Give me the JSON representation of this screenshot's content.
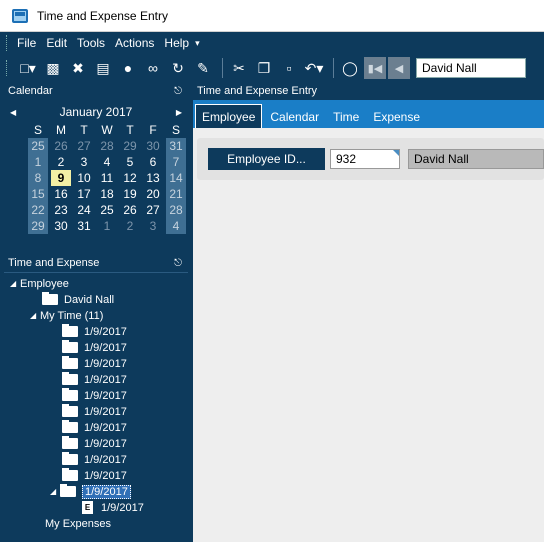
{
  "window": {
    "title": "Time and Expense Entry"
  },
  "menu": [
    "File",
    "Edit",
    "Tools",
    "Actions",
    "Help"
  ],
  "toolbar": {
    "combo_value": "David Nall",
    "icons": [
      "new-icon",
      "save-icon",
      "delete-icon",
      "book-icon",
      "comment-icon",
      "attach-icon",
      "refresh-icon",
      "brush-icon",
      "cut-icon",
      "copy-icon",
      "paste-icon",
      "undo-icon",
      "binoculars-icon",
      "first-record-icon",
      "previous-record-icon"
    ]
  },
  "calendar": {
    "header": "Calendar",
    "month": "January 2017",
    "dow": [
      "S",
      "M",
      "T",
      "W",
      "T",
      "F",
      "S"
    ],
    "weeks": [
      [
        "25",
        "26",
        "27",
        "28",
        "29",
        "30",
        "31"
      ],
      [
        "1",
        "2",
        "3",
        "4",
        "5",
        "6",
        "7"
      ],
      [
        "8",
        "9",
        "10",
        "11",
        "12",
        "13",
        "14"
      ],
      [
        "15",
        "16",
        "17",
        "18",
        "19",
        "20",
        "21"
      ],
      [
        "22",
        "23",
        "24",
        "25",
        "26",
        "27",
        "28"
      ],
      [
        "29",
        "30",
        "31",
        "1",
        "2",
        "3",
        "4"
      ]
    ],
    "today": "9"
  },
  "tree": {
    "header": "Time and Expense",
    "root": "Employee",
    "employee": "David Nall",
    "my_time": "My Time (11)",
    "time_entries": [
      "1/9/2017",
      "1/9/2017",
      "1/9/2017",
      "1/9/2017",
      "1/9/2017",
      "1/9/2017",
      "1/9/2017",
      "1/9/2017",
      "1/9/2017",
      "1/9/2017"
    ],
    "selected_entry": "1/9/2017",
    "child_entry": "1/9/2017",
    "child_badge": "E",
    "my_expenses": "My Expenses"
  },
  "main": {
    "header": "Time and Expense Entry",
    "tabs": [
      "Employee",
      "Calendar",
      "Time",
      "Expense"
    ],
    "employee_id_label": "Employee ID...",
    "employee_id_value": "932",
    "employee_name": "David Nall"
  },
  "colors": {
    "chrome": "#0d3a5c",
    "tab_strip": "#1a7ec7",
    "today": "#f3f0a5"
  }
}
